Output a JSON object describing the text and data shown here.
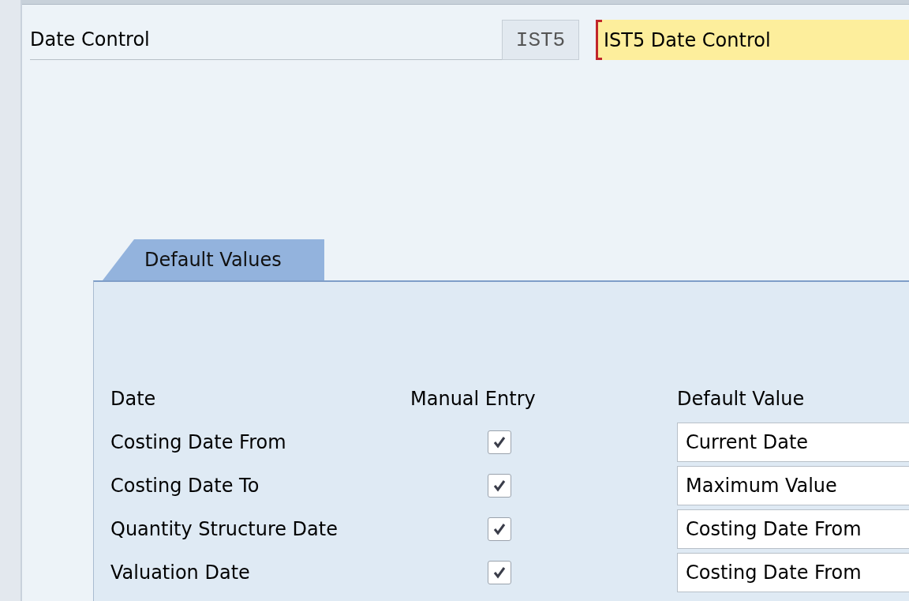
{
  "header": {
    "label": "Date Control",
    "code": "IST5",
    "description": "IST5 Date Control"
  },
  "tabs": [
    {
      "label": "Default Values",
      "selected": true
    }
  ],
  "table": {
    "columns": [
      "Date",
      "Manual Entry",
      "Default Value"
    ],
    "rows": [
      {
        "date": "Costing Date From",
        "manual_entry": true,
        "default_value": "Current Date"
      },
      {
        "date": "Costing Date To",
        "manual_entry": true,
        "default_value": "Maximum Value"
      },
      {
        "date": "Quantity Structure Date",
        "manual_entry": true,
        "default_value": "Costing Date From"
      },
      {
        "date": "Valuation Date",
        "manual_entry": true,
        "default_value": "Costing Date From"
      }
    ]
  }
}
